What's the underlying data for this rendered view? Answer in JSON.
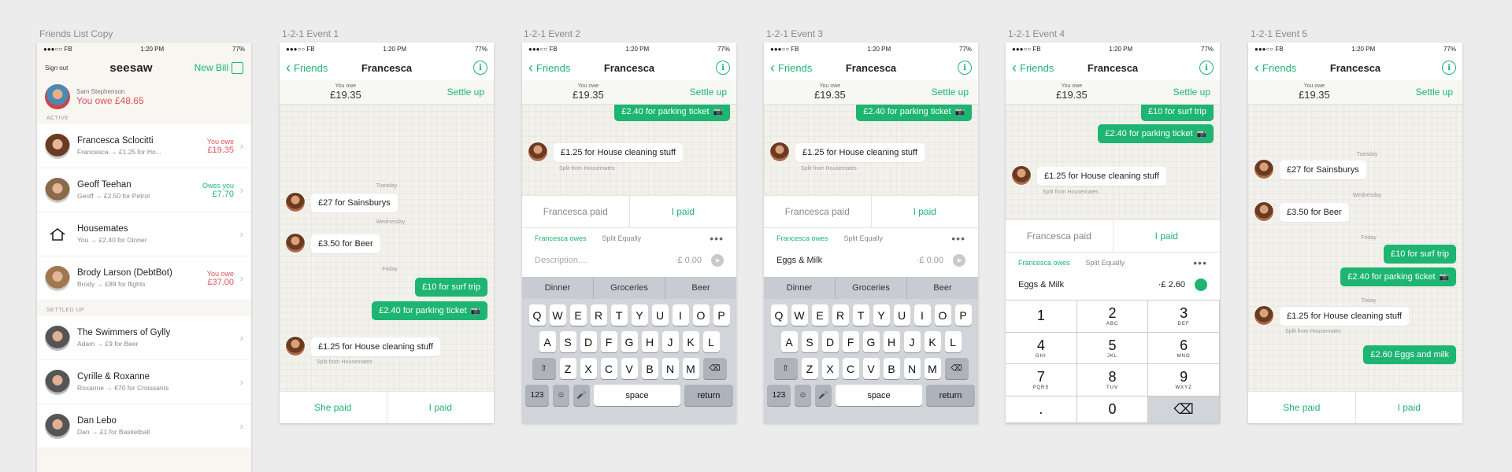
{
  "artboards": {
    "a0": "Friends List Copy",
    "a1": "1-2-1 Event 1",
    "a2": "1-2-1 Event 2",
    "a3": "1-2-1 Event 3",
    "a4": "1-2-1 Event 4",
    "a5": "1-2-1 Event 5"
  },
  "status": {
    "carrier": "●●●○○ FB",
    "time": "1:20 PM",
    "battery": "77%"
  },
  "nav": {
    "back": "Friends",
    "title": "Francesca"
  },
  "owe": {
    "caption": "You owe",
    "amount": "£19.35",
    "settle": "Settle up"
  },
  "days": {
    "tuesday": "Tuesday",
    "wednesday": "Wednesday",
    "friday": "Friday",
    "today": "Today"
  },
  "msgs": {
    "sainsburys": "£27 for Sainsburys",
    "beer": "£3.50 for Beer",
    "surf": "£10 for surf trip",
    "parking": "£2.40 for parking ticket",
    "cleaning": "£1.25 for House cleaning stuff",
    "split": "Split from Housemates",
    "eggs_milk_msg": "£2.60 Eggs and milk"
  },
  "paybar": {
    "she": "She paid",
    "i": "I paid"
  },
  "entry": {
    "francesca_paid": "Francesca paid",
    "i_paid": "I paid",
    "owes": "Francesca owes",
    "split_equally": "Split Equally",
    "more": "•••",
    "desc_placeholder": "Description....",
    "zero": "·£ 0.00",
    "eggs": "Eggs & Milk",
    "eggs_amt": "·£ 2.60"
  },
  "suggest": [
    "Dinner",
    "Groceries",
    "Beer"
  ],
  "keys": {
    "row1": [
      "Q",
      "W",
      "E",
      "R",
      "T",
      "Y",
      "U",
      "I",
      "O",
      "P"
    ],
    "row2": [
      "A",
      "S",
      "D",
      "F",
      "G",
      "H",
      "J",
      "K",
      "L"
    ],
    "row3": [
      "Z",
      "X",
      "C",
      "V",
      "B",
      "N",
      "M"
    ],
    "num": "123",
    "space": "space",
    "ret": "return"
  },
  "numpad": [
    {
      "d": "1",
      "l": ""
    },
    {
      "d": "2",
      "l": "ABC"
    },
    {
      "d": "3",
      "l": "DEF"
    },
    {
      "d": "4",
      "l": "GHI"
    },
    {
      "d": "5",
      "l": "JKL"
    },
    {
      "d": "6",
      "l": "MNO"
    },
    {
      "d": "7",
      "l": "PQRS"
    },
    {
      "d": "8",
      "l": "TUV"
    },
    {
      "d": "9",
      "l": "WXYZ"
    },
    {
      "d": ".",
      "l": ""
    },
    {
      "d": "0",
      "l": ""
    },
    {
      "d": "⌫",
      "l": ""
    }
  ],
  "friends": {
    "signout": "Sign out",
    "logo": "seesaw",
    "newbill": "New Bill",
    "me_name": "Sam Stephenson",
    "me_owe": "You owe £48.65",
    "active": "ACTIVE",
    "settled": "SETTLED UP",
    "active_rows": [
      {
        "name": "Francesca Sclocitti",
        "sub": "Francesca → £1.25 for Ho...",
        "bal_label": "You owe",
        "bal": "£19.35",
        "tone": "red"
      },
      {
        "name": "Geoff Teehan",
        "sub": "Geoff → £2.50 for Petrol",
        "bal_label": "Owes you",
        "bal": "£7.70",
        "tone": "green"
      },
      {
        "name": "Housemates",
        "sub": "You → £2.40 for Dinner",
        "bal_label": "",
        "bal": "",
        "tone": ""
      },
      {
        "name": "Brody Larson (DebtBot)",
        "sub": "Brody → £89 for flights",
        "bal_label": "You owe",
        "bal": "£37.00",
        "tone": "red"
      }
    ],
    "settled_rows": [
      {
        "name": "The Swimmers of Gylly",
        "sub": "Adam → £9 for Beer"
      },
      {
        "name": "Cyrille & Roxanne",
        "sub": "Roxanne → €70 for Croissants"
      },
      {
        "name": "Dan Lebo",
        "sub": "Dan → £1 for Basketball"
      }
    ]
  }
}
